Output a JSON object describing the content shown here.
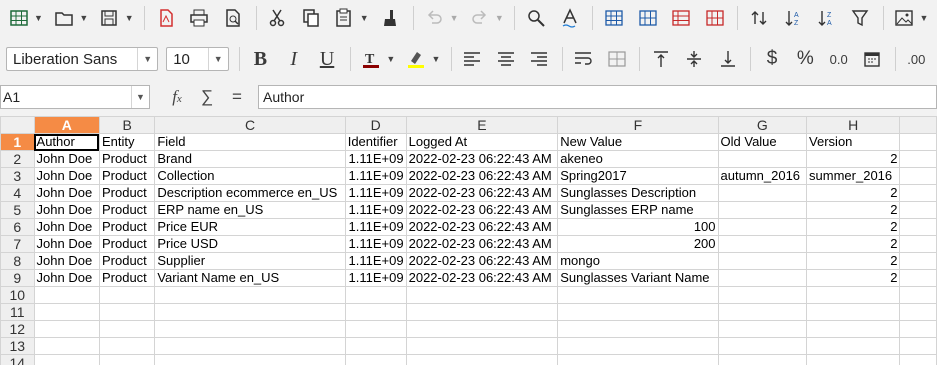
{
  "toolbar_standard": {
    "icons": [
      "sheet-icon",
      "open-icon",
      "save-icon",
      "export-pdf-icon",
      "print-icon",
      "print-preview-icon",
      "cut-icon",
      "copy-icon",
      "paste-icon",
      "clone-formatting-icon",
      "undo-icon",
      "redo-icon",
      "find-replace-icon",
      "spelling-icon",
      "row-icon",
      "column-icon",
      "insert-rows-icon",
      "delete-rows-icon",
      "sort-ascending-icon",
      "sort-descending-icon",
      "autofilter-icon",
      "insert-image-icon"
    ]
  },
  "toolbar_format": {
    "font_name": "Liberation Sans",
    "font_size": "10",
    "font_color": "#8b0000",
    "highlight_color": "#ffff00",
    "currency_symbol": "$",
    "percent_symbol": "%",
    "decimal_label": "0.0",
    "add_decimal_label": ".00"
  },
  "formula_bar": {
    "cell_ref": "A1",
    "formula": "Author"
  },
  "sheet": {
    "columns": [
      "A",
      "B",
      "C",
      "D",
      "E",
      "F",
      "G",
      "H"
    ],
    "rows": [
      {
        "num": "1",
        "cells": [
          "Author",
          "Entity",
          "Field",
          "Identifier",
          "Logged At",
          "New Value",
          "Old Value",
          "Version"
        ]
      },
      {
        "num": "2",
        "cells": [
          "John Doe",
          "Product",
          "Brand",
          "1.11E+09",
          "2022-02-23 06:22:43 AM",
          "akeneo",
          "",
          "2"
        ]
      },
      {
        "num": "3",
        "cells": [
          "John Doe",
          "Product",
          "Collection",
          "1.11E+09",
          "2022-02-23 06:22:43 AM",
          "Spring2017",
          "autumn_2016",
          "summer_2016"
        ]
      },
      {
        "num": "4",
        "cells": [
          "John Doe",
          "Product",
          "Description ecommerce en_US",
          "1.11E+09",
          "2022-02-23 06:22:43 AM",
          "Sunglasses Description",
          "",
          "2"
        ]
      },
      {
        "num": "5",
        "cells": [
          "John Doe",
          "Product",
          "ERP name en_US",
          "1.11E+09",
          "2022-02-23 06:22:43 AM",
          "Sunglasses ERP name",
          "",
          "2"
        ]
      },
      {
        "num": "6",
        "cells": [
          "John Doe",
          "Product",
          "Price EUR",
          "1.11E+09",
          "2022-02-23 06:22:43 AM",
          "100",
          "",
          "2"
        ]
      },
      {
        "num": "7",
        "cells": [
          "John Doe",
          "Product",
          "Price USD",
          "1.11E+09",
          "2022-02-23 06:22:43 AM",
          "200",
          "",
          "2"
        ]
      },
      {
        "num": "8",
        "cells": [
          "John Doe",
          "Product",
          "Supplier",
          "1.11E+09",
          "2022-02-23 06:22:43 AM",
          "mongo",
          "",
          "2"
        ]
      },
      {
        "num": "9",
        "cells": [
          "John Doe",
          "Product",
          "Variant Name en_US",
          "1.11E+09",
          "2022-02-23 06:22:43 AM",
          "Sunglasses Variant Name",
          "",
          "2"
        ]
      },
      {
        "num": "10",
        "cells": [
          "",
          "",
          "",
          "",
          "",
          "",
          "",
          ""
        ]
      },
      {
        "num": "11",
        "cells": [
          "",
          "",
          "",
          "",
          "",
          "",
          "",
          ""
        ]
      },
      {
        "num": "12",
        "cells": [
          "",
          "",
          "",
          "",
          "",
          "",
          "",
          ""
        ]
      },
      {
        "num": "13",
        "cells": [
          "",
          "",
          "",
          "",
          "",
          "",
          "",
          ""
        ]
      },
      {
        "num": "14",
        "cells": [
          "",
          "",
          "",
          "",
          "",
          "",
          "",
          ""
        ]
      }
    ]
  }
}
